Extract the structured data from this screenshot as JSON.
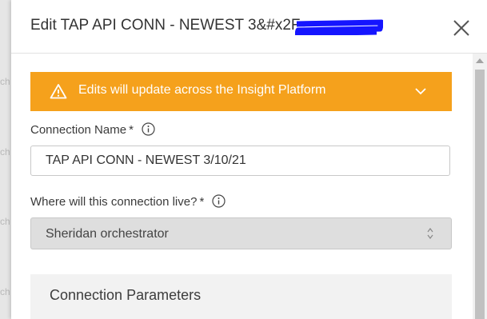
{
  "background": {
    "ghost_text": "ch"
  },
  "modal": {
    "title": "Edit TAP API CONN - NEWEST 3&#x2F;",
    "close_icon": "close-icon"
  },
  "alert": {
    "text": "Edits will update across the Insight Platform",
    "icon": "warning-icon",
    "expand_icon": "chevron-down-icon",
    "color": "#f5a11c"
  },
  "form": {
    "connection_name": {
      "label": "Connection Name",
      "required_mark": "*",
      "value": "TAP API CONN - NEWEST 3/10/21"
    },
    "location": {
      "label": "Where will this connection live?",
      "required_mark": "*",
      "selected": "Sheridan orchestrator"
    }
  },
  "sections": {
    "connection_parameters": "Connection Parameters"
  }
}
